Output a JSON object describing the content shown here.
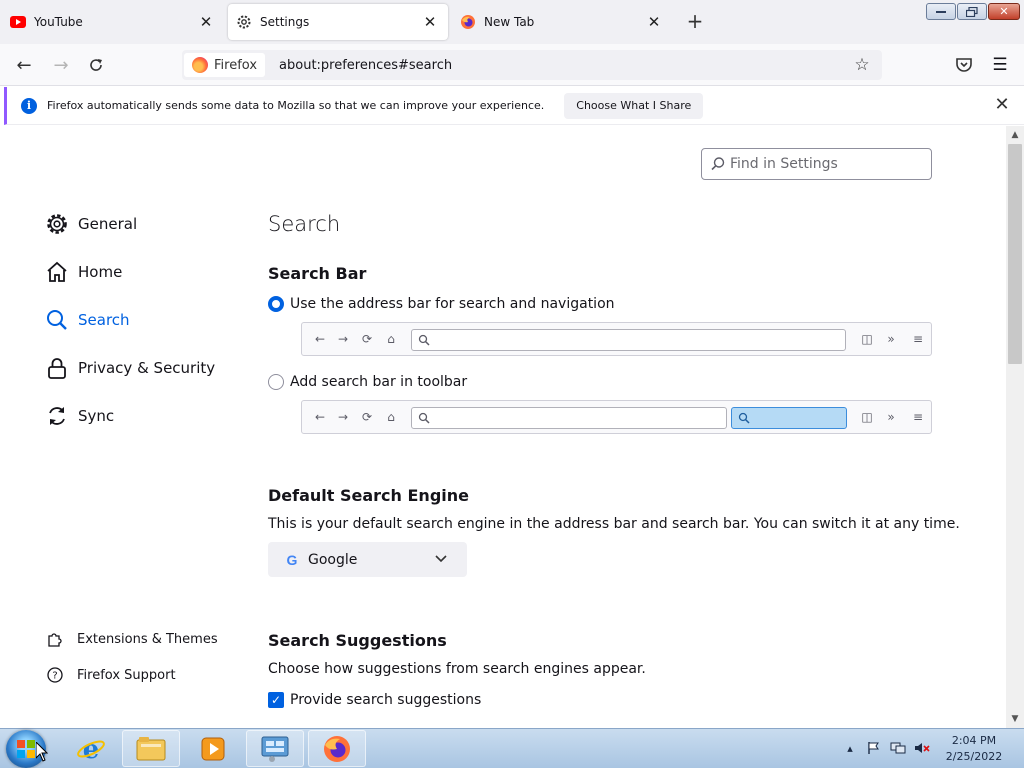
{
  "tabs": [
    {
      "label": "YouTube"
    },
    {
      "label": "Settings"
    },
    {
      "label": "New Tab"
    }
  ],
  "navbar": {
    "identity_label": "Firefox",
    "url": "about:preferences#search"
  },
  "notification": {
    "text": "Firefox automatically sends some data to Mozilla so that we can improve your experience.",
    "button_label": "Choose What I Share"
  },
  "find": {
    "placeholder": "Find in Settings"
  },
  "categories": {
    "general": "General",
    "home": "Home",
    "search": "Search",
    "privacy": "Privacy & Security",
    "sync": "Sync",
    "selected": "search"
  },
  "footer_links": {
    "extensions": "Extensions & Themes",
    "support": "Firefox Support"
  },
  "page": {
    "title": "Search",
    "search_bar": {
      "heading": "Search Bar",
      "option_address": "Use the address bar for search and navigation",
      "option_toolbar": "Add search bar in toolbar",
      "selected": "address"
    },
    "default_engine": {
      "heading": "Default Search Engine",
      "description": "This is your default search engine in the address bar and search bar. You can switch it at any time.",
      "selected": "Google"
    },
    "suggestions": {
      "heading": "Search Suggestions",
      "description": "Choose how suggestions from search engines appear.",
      "provide_label": "Provide search suggestions",
      "provide_checked": true
    }
  },
  "taskbar": {
    "time": "2:04 PM",
    "date": "2/25/2022"
  },
  "colors": {
    "accent": "#0061e0",
    "notification_border": "#9059ff",
    "tab_strip": "#f0f0f4"
  },
  "icons": {
    "youtube_tab": "youtube-icon",
    "settings_tab": "gear-icon",
    "newtab_tab": "firefox-icon",
    "pocket": "pocket-icon",
    "menu": "hamburger-menu-icon"
  }
}
